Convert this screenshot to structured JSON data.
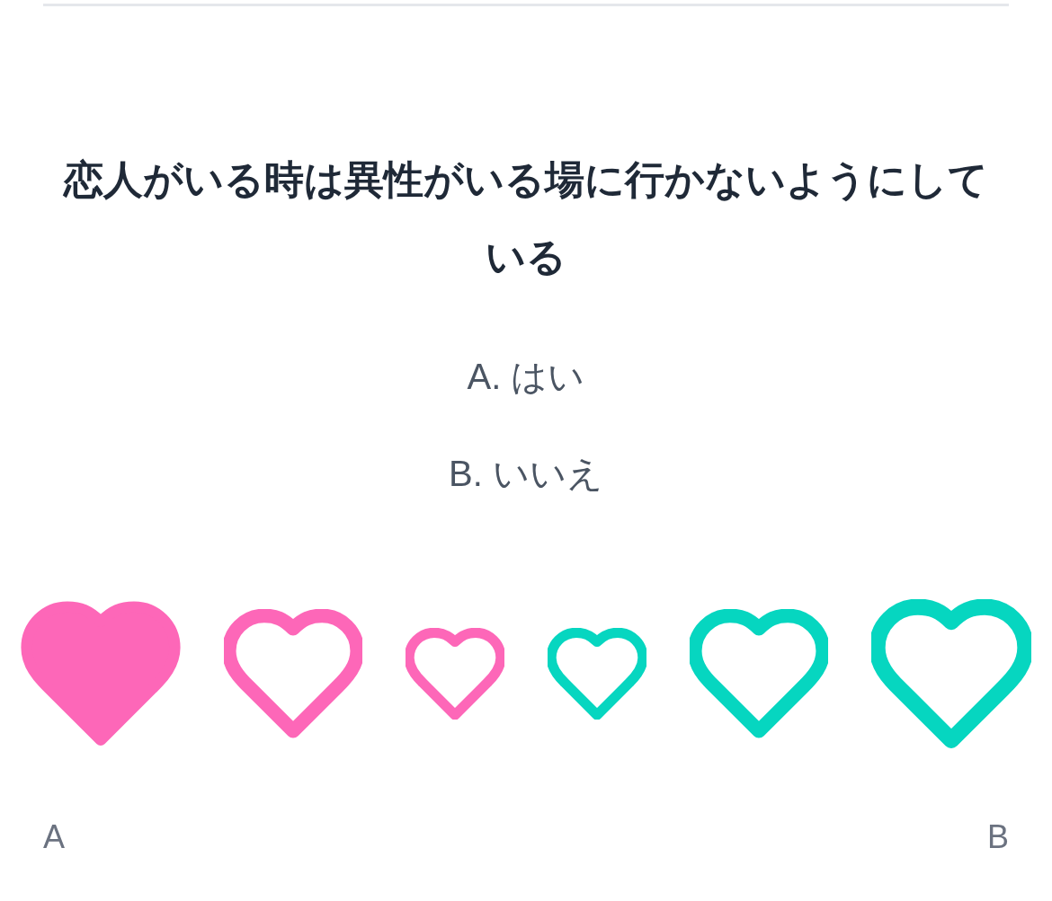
{
  "question": "恋人がいる時は異性がいる場に行かないようにしている",
  "answers": [
    "A. はい",
    "B. いいえ"
  ],
  "options": [
    {
      "selected": true,
      "color": "#fd67b8"
    },
    {
      "selected": false,
      "color": "#fd67b8"
    },
    {
      "selected": false,
      "color": "#fd67b8"
    },
    {
      "selected": false,
      "color": "#06d6c0"
    },
    {
      "selected": false,
      "color": "#06d6c0"
    },
    {
      "selected": false,
      "color": "#06d6c0"
    }
  ],
  "scale_labels": {
    "left": "A",
    "right": "B"
  }
}
